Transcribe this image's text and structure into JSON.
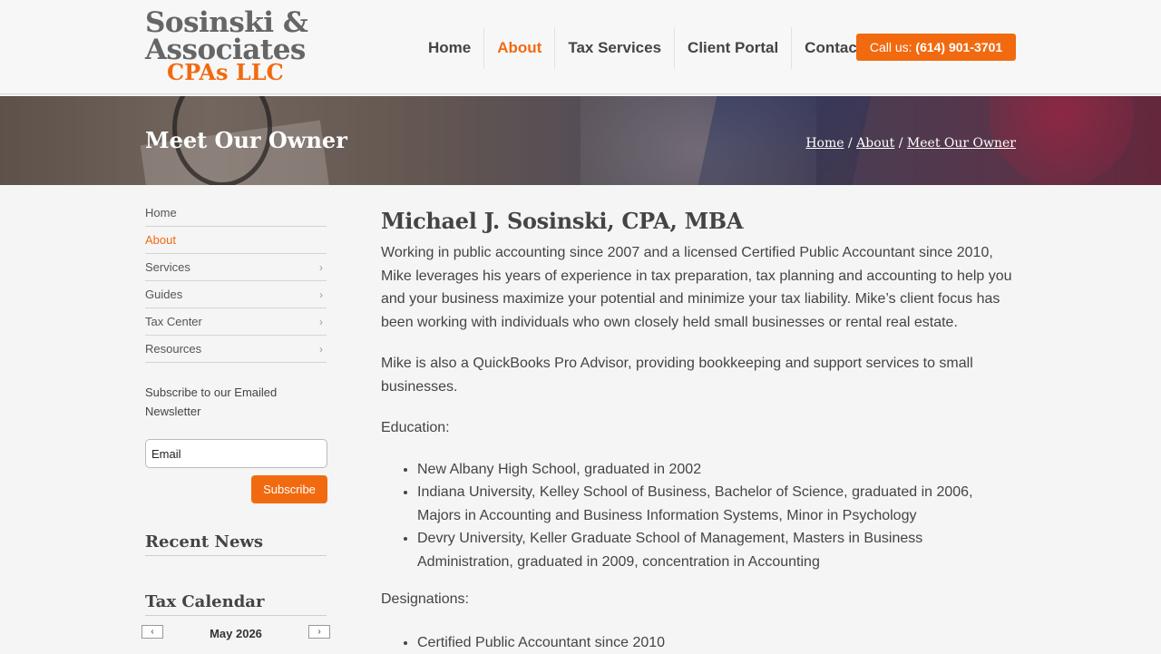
{
  "logo": {
    "line1": "Sosinski &",
    "line2": "Associates",
    "line3": "CPAs LLC"
  },
  "nav": {
    "items": [
      {
        "label": "Home"
      },
      {
        "label": "About"
      },
      {
        "label": "Tax Services"
      },
      {
        "label": "Client Portal"
      },
      {
        "label": "Contact"
      }
    ],
    "active": "About",
    "call_prefix": "Call us:",
    "call_number": "(614) 901-3701"
  },
  "banner": {
    "title": "Meet Our Owner",
    "breadcrumb": [
      {
        "label": "Home"
      },
      {
        "label": "About"
      },
      {
        "label": "Meet Our Owner"
      }
    ],
    "separator": "/"
  },
  "sidebar": {
    "menu": [
      {
        "label": "Home",
        "has_children": false
      },
      {
        "label": "About",
        "has_children": false
      },
      {
        "label": "Services",
        "has_children": true
      },
      {
        "label": "Guides",
        "has_children": true
      },
      {
        "label": "Tax Center",
        "has_children": true
      },
      {
        "label": "Resources",
        "has_children": true
      }
    ],
    "newsletter_text": "Subscribe to our Emailed Newsletter",
    "email_placeholder": "Email",
    "subscribe_label": "Subscribe",
    "recent_news_heading": "Recent News",
    "tax_calendar_heading": "Tax Calendar",
    "calendar_month": "May 2026",
    "calendar_prev": "‹",
    "calendar_next": "›"
  },
  "main": {
    "heading": "Michael J. Sosinski, CPA, MBA",
    "paragraph1": "Working in public accounting since 2007 and a licensed Certified Public Accountant since 2010, Mike leverages his years of experience in tax preparation, tax planning and accounting to help you and your business maximize your potential and minimize your tax liability. Mike’s client focus has been working with individuals who own closely held small businesses or rental real estate.",
    "paragraph2": "Mike is also a QuickBooks Pro Advisor, providing bookkeeping and support services to small businesses.",
    "education_label": "Education:",
    "education": [
      "New Albany High School, graduated in 2002",
      "Indiana University, Kelley School of Business, Bachelor of Science, graduated in 2006, Majors in Accounting and Business Information Systems, Minor in Psychology",
      "Devry University, Keller Graduate School of Management, Masters in Business Administration, graduated in 2009, concentration in Accounting"
    ],
    "designations_label": "Designations:",
    "designations": [
      "Certified Public Accountant since 2010"
    ]
  },
  "colors": {
    "accent": "#f26a10",
    "text": "#444444",
    "background": "#f5f5f5"
  }
}
